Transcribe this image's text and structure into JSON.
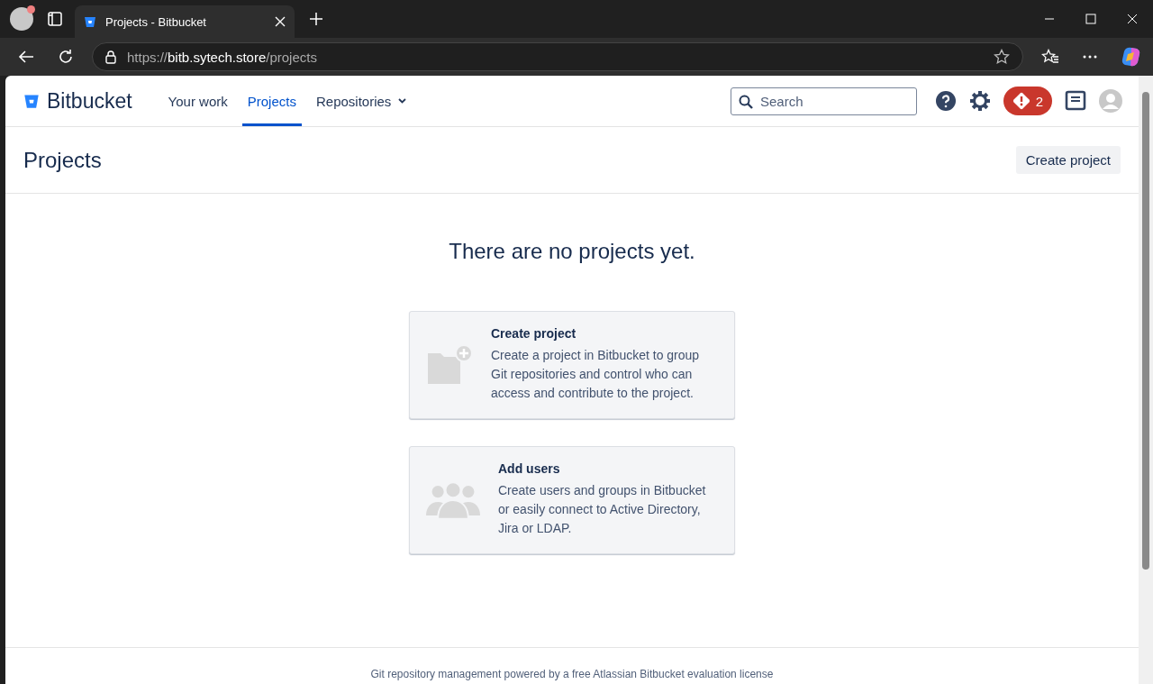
{
  "browser": {
    "tab_title": "Projects - Bitbucket",
    "url": {
      "scheme": "https://",
      "host": "bitb.sytech.store",
      "path": "/projects"
    }
  },
  "nav": {
    "logo": "Bitbucket",
    "items": [
      {
        "label": "Your work",
        "selected": false,
        "dropdown": false
      },
      {
        "label": "Projects",
        "selected": true,
        "dropdown": false
      },
      {
        "label": "Repositories",
        "selected": false,
        "dropdown": true
      }
    ],
    "search": {
      "placeholder": "Search"
    },
    "alert_count": "2"
  },
  "page": {
    "title": "Projects",
    "action": "Create project",
    "empty_message": "There are no projects yet.",
    "cards": [
      {
        "kind": "folder",
        "title": "Create project",
        "text": "Create a project in Bitbucket to group Git repositories and control who can access and contribute to the project."
      },
      {
        "kind": "users",
        "title": "Add users",
        "text": "Create users and groups in Bitbucket or easily connect to Active Directory, Jira or LDAP."
      }
    ]
  },
  "footer": "Git repository management powered by a free Atlassian Bitbucket evaluation license"
}
